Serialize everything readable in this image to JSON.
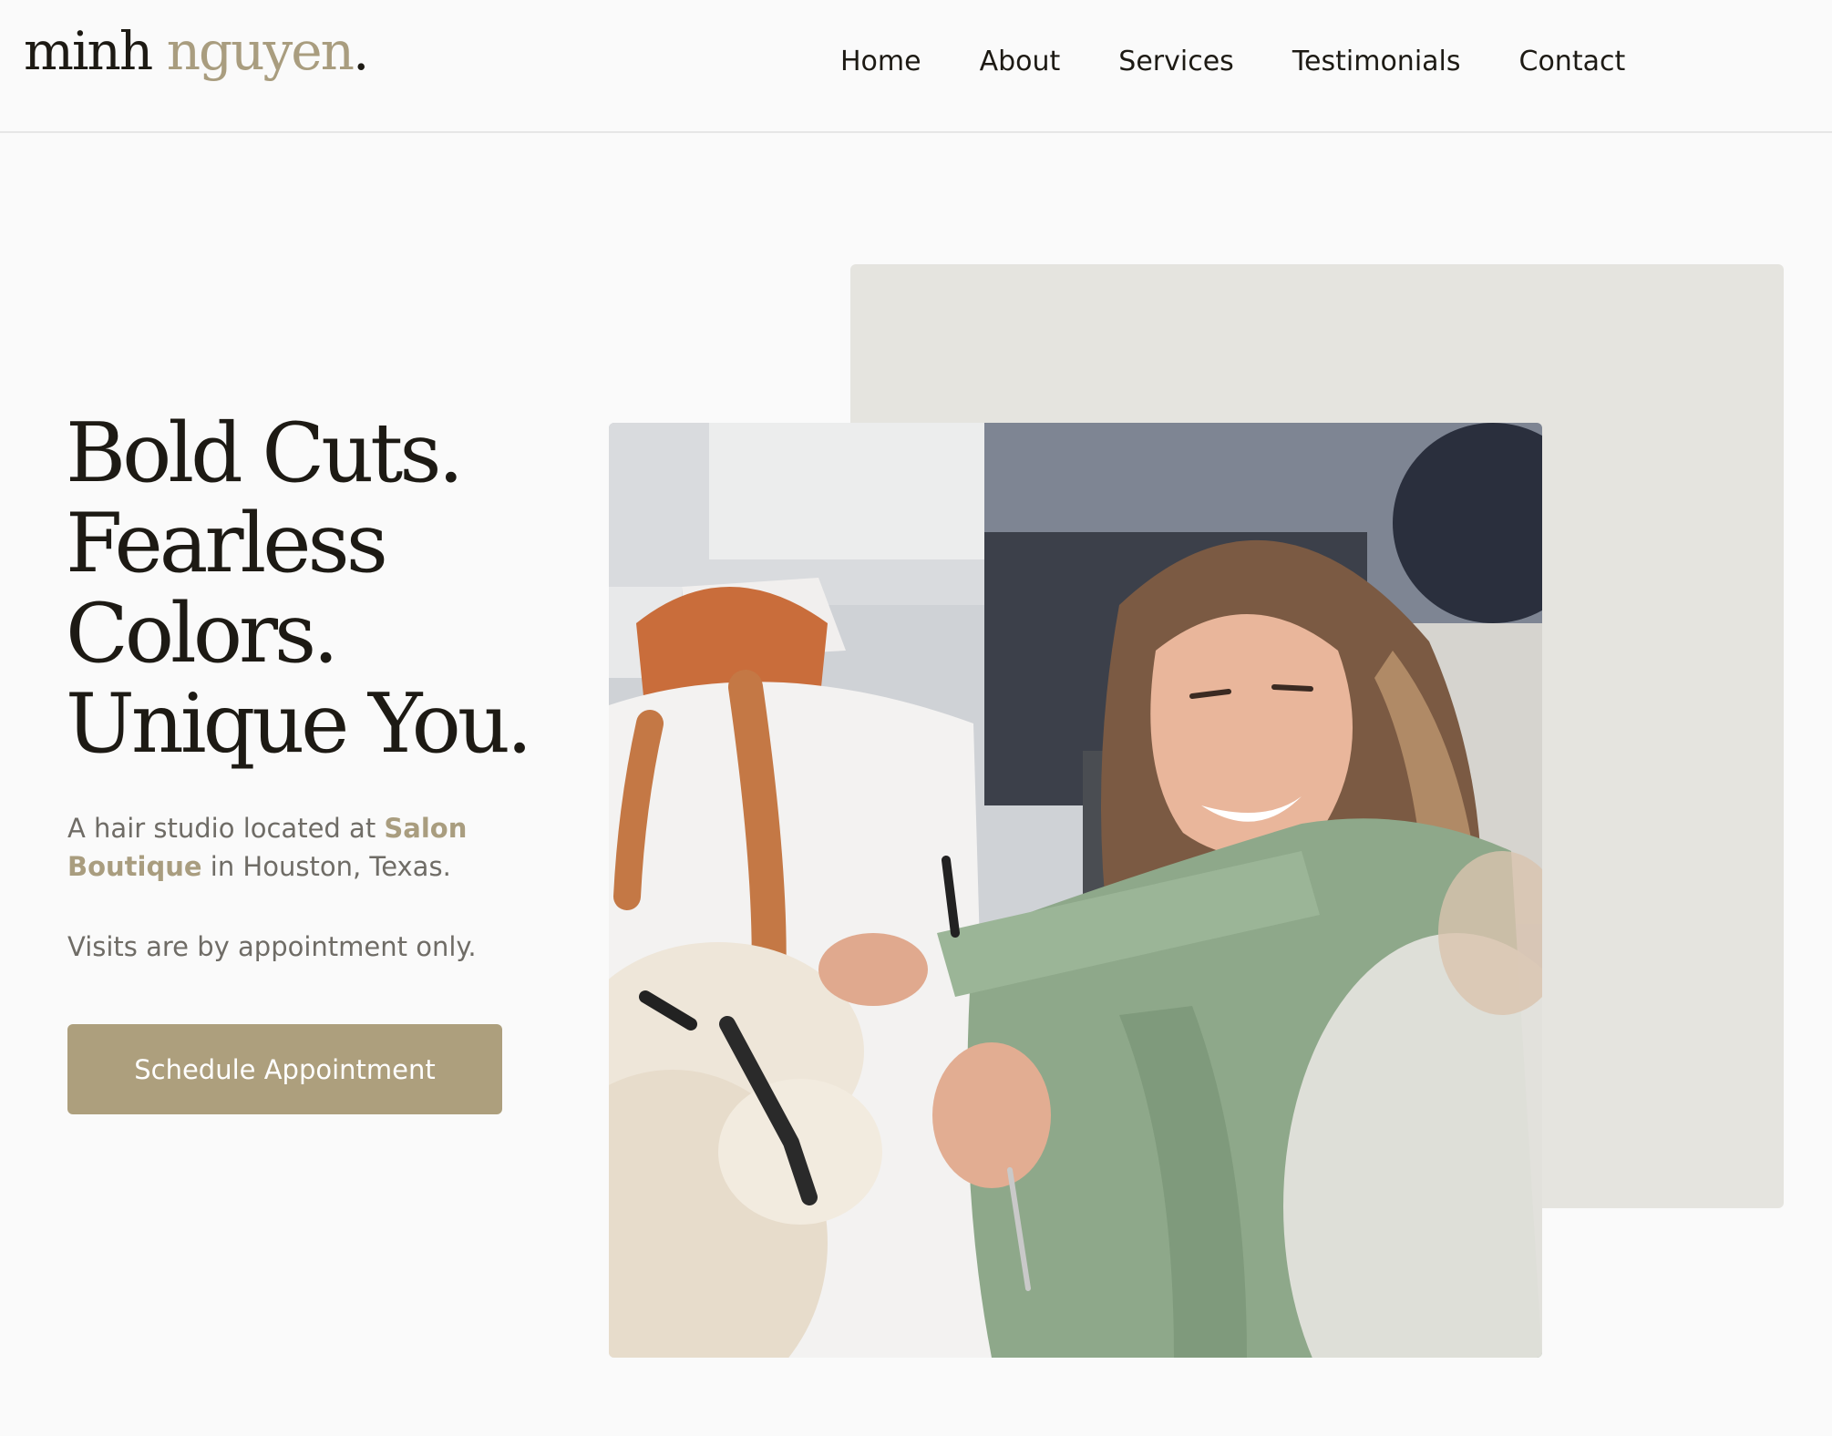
{
  "header": {
    "logo": {
      "first": "minh",
      "last": "nguyen",
      "dot": "."
    },
    "nav": [
      {
        "label": "Home"
      },
      {
        "label": "About"
      },
      {
        "label": "Services"
      },
      {
        "label": "Testimonials"
      },
      {
        "label": "Contact"
      }
    ]
  },
  "hero": {
    "title_lines": [
      "Bold Cuts.",
      "Fearless",
      "Colors.",
      "Unique You."
    ],
    "intro": {
      "prefix": "A hair studio located at ",
      "highlight": "Salon Boutique",
      "suffix": " in Houston, Texas."
    },
    "note": "Visits are by appointment only.",
    "cta_label": "Schedule Appointment"
  },
  "photo": {
    "subject": "stylist-smiling-styling-hair"
  },
  "colors": {
    "accent": "#ad9f7d",
    "logo_accent": "#a99d7f",
    "text": "#1d1a14",
    "muted": "#6f6c66",
    "background": "#fafafa",
    "backdrop": "#e5e4df"
  }
}
